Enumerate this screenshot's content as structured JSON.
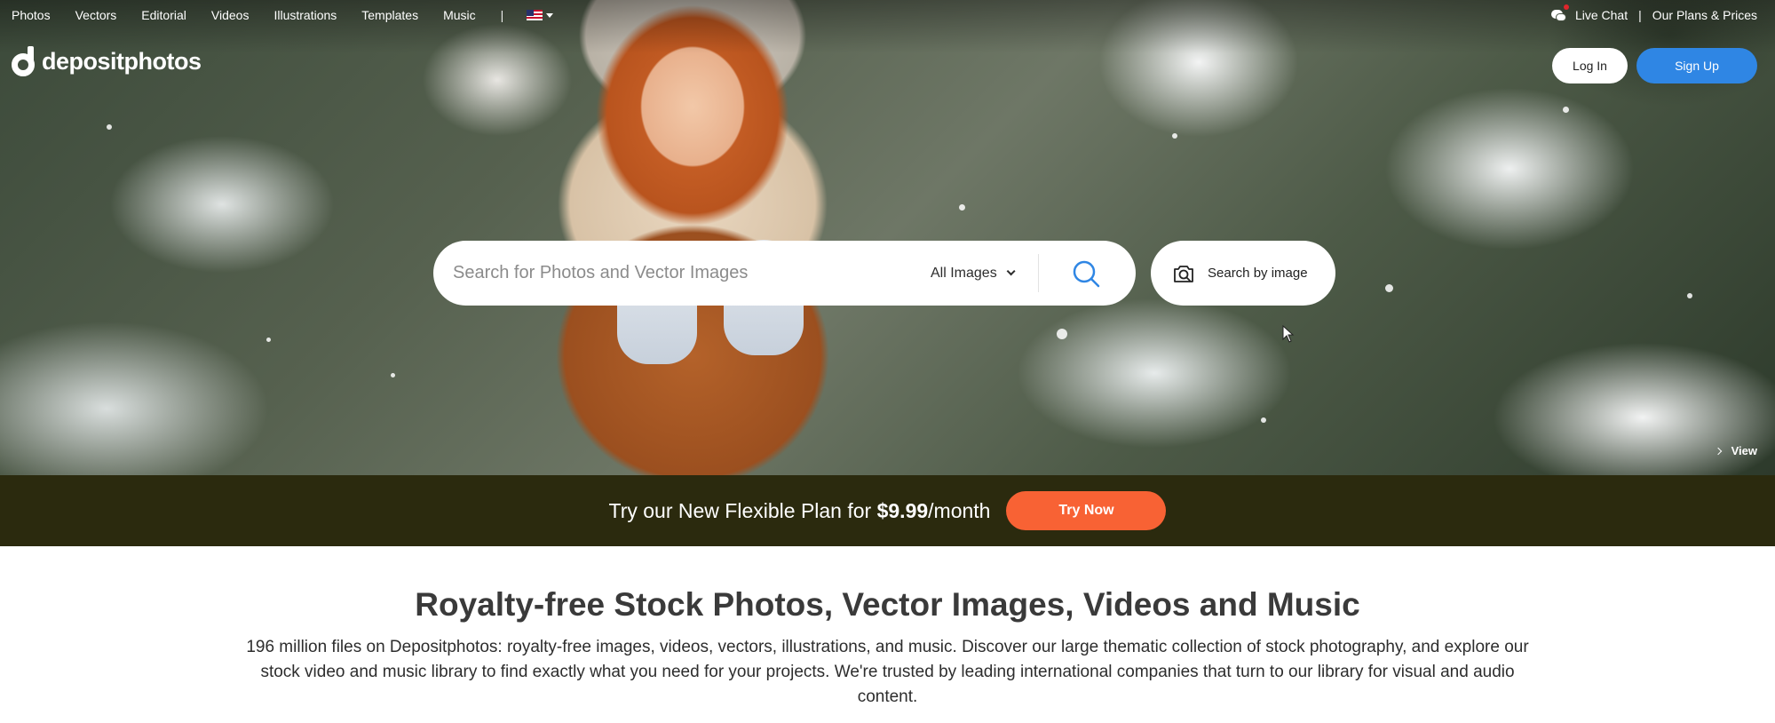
{
  "nav": {
    "items": [
      "Photos",
      "Vectors",
      "Editorial",
      "Videos",
      "Illustrations",
      "Templates",
      "Music"
    ],
    "separator": "|",
    "language_icon": "us-flag-icon"
  },
  "topright": {
    "live_chat": "Live Chat",
    "divider": "|",
    "plans": "Our Plans & Prices"
  },
  "brand": {
    "logo_text": "depositphotos"
  },
  "auth": {
    "login": "Log In",
    "signup": "Sign Up"
  },
  "search": {
    "placeholder": "Search for Photos and Vector Images",
    "value": "",
    "type_selected": "All Images",
    "image_search_label": "Search by image"
  },
  "hero": {
    "view_label": "View"
  },
  "promo": {
    "text_before": "Try our New Flexible Plan for ",
    "price": "$9.99",
    "text_after": "/month",
    "cta": "Try Now"
  },
  "content": {
    "title": "Royalty-free Stock Photos, Vector Images, Videos and Music",
    "description": "196 million files on Depositphotos: royalty-free images, videos, vectors, illustrations, and music. Discover our large thematic collection of stock photography, and explore our stock video and music library to find exactly what you need for your projects. We're trusted by leading international companies that turn to our library for visual and audio content."
  },
  "colors": {
    "signup": "#2f86e4",
    "promo_bg": "#2b2a0e",
    "cta": "#f86234",
    "search_icon": "#2f86e4"
  }
}
